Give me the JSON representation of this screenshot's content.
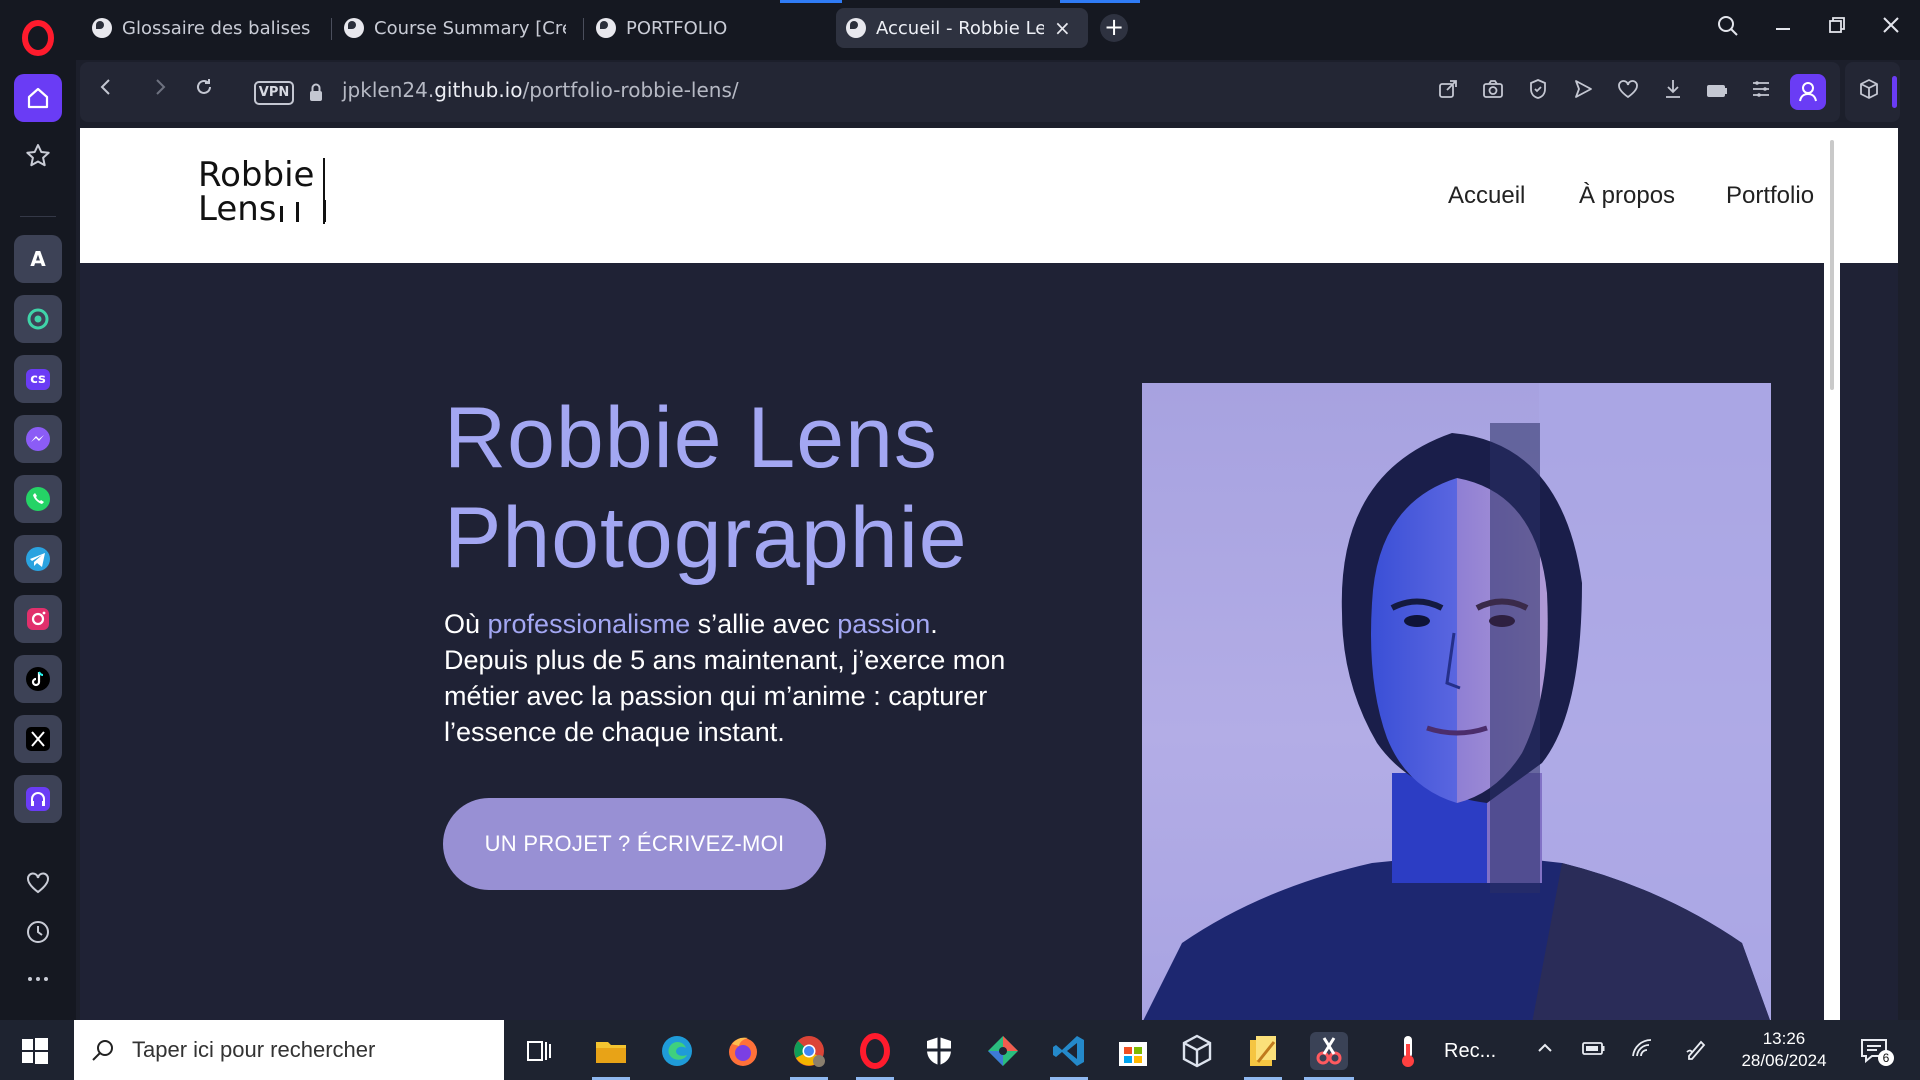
{
  "browser": {
    "tabs": [
      {
        "title": "Glossaire des balises HTM",
        "active": false
      },
      {
        "title": "Course Summary [Créez vo",
        "active": false
      },
      {
        "title": "PORTFOLIO",
        "active": false
      },
      {
        "title": "Accueil - Robbie Lens",
        "active": true
      }
    ],
    "new_tab": "+",
    "close_tab": "×",
    "url_prefix": "jpklen24.",
    "url_domain": "github.io",
    "url_path": "/portfolio-robbie-lens/",
    "vpn_label": "VPN"
  },
  "site": {
    "logo_line1": "Robbie",
    "logo_line2": "Lens",
    "nav": [
      "Accueil",
      "À propos",
      "Portfolio"
    ],
    "hero_title_line1": "Robbie Lens",
    "hero_title_line2": "Photographie",
    "hero_text": {
      "p1": "Où ",
      "hl1": "professionalisme",
      "p2": " s’allie avec ",
      "hl2": "passion",
      "p3": ".",
      "line2": "Depuis plus de 5 ans maintenant, j’exerce mon métier avec la passion qui m’anime : capturer l’essence de chaque instant."
    },
    "cta": "UN PROJET ? ÉCRIVEZ-MOI"
  },
  "taskbar": {
    "search_placeholder": "Taper ici pour rechercher",
    "app_label": "Rec...",
    "time": "13:26",
    "date": "28/06/2024",
    "notification_count": "6"
  },
  "colors": {
    "accent": "#a3a7f2",
    "cta": "#9890d4",
    "hero_bg": "#1f2235",
    "browser_active": "#2f7bf5"
  }
}
